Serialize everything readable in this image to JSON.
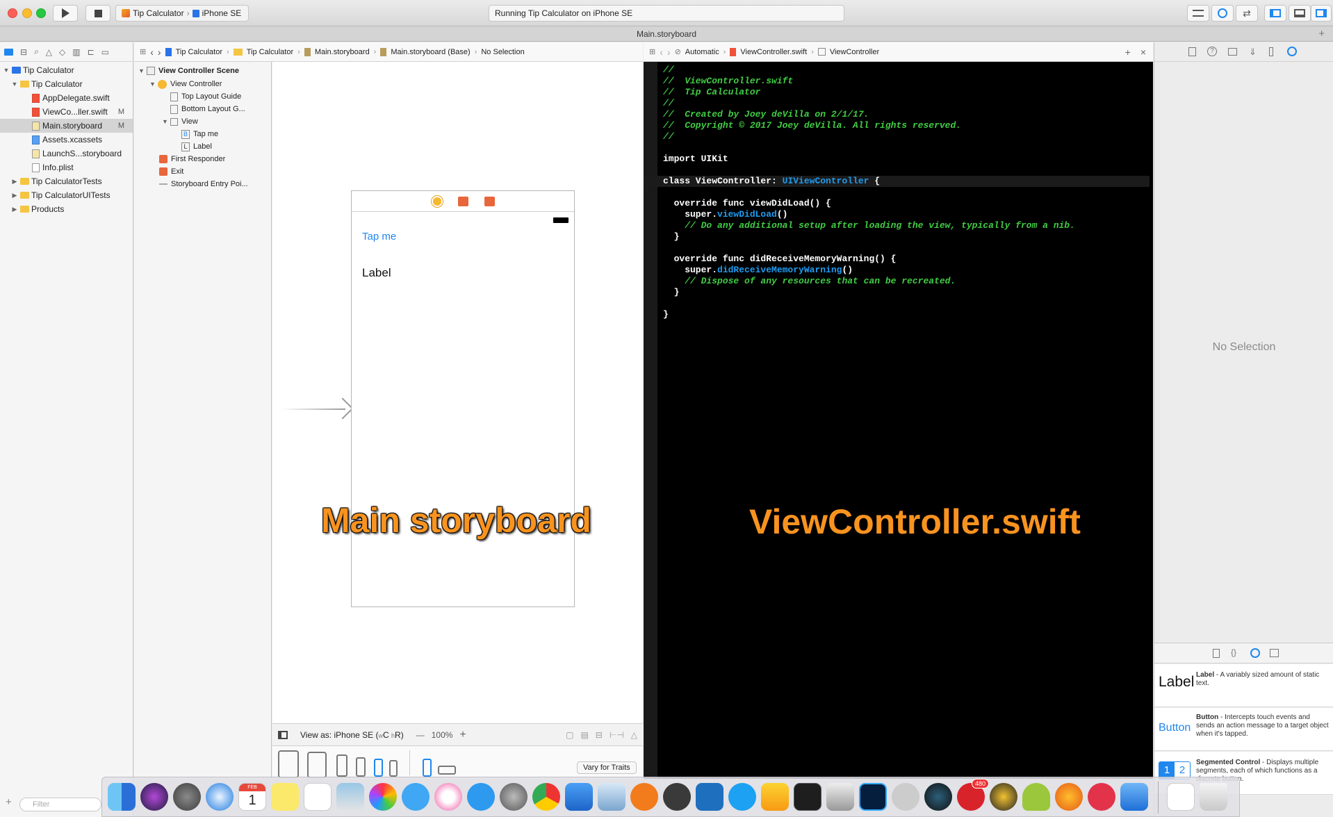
{
  "toolbar": {
    "scheme_project": "Tip Calculator",
    "scheme_device": "iPhone SE",
    "status": "Running Tip Calculator on iPhone SE"
  },
  "tab_title": "Main.storyboard",
  "navigator": {
    "items": [
      {
        "label": "Tip Calculator",
        "badge": ""
      },
      {
        "label": "Tip Calculator",
        "badge": ""
      },
      {
        "label": "AppDelegate.swift",
        "badge": ""
      },
      {
        "label": "ViewCo...ller.swift",
        "badge": "M"
      },
      {
        "label": "Main.storyboard",
        "badge": "M"
      },
      {
        "label": "Assets.xcassets",
        "badge": ""
      },
      {
        "label": "LaunchS...storyboard",
        "badge": ""
      },
      {
        "label": "Info.plist",
        "badge": ""
      },
      {
        "label": "Tip CalculatorTests",
        "badge": ""
      },
      {
        "label": "Tip CalculatorUITests",
        "badge": ""
      },
      {
        "label": "Products",
        "badge": ""
      }
    ],
    "filter_placeholder": "Filter"
  },
  "outline": {
    "scene": "View Controller Scene",
    "items": [
      "View Controller",
      "Top Layout Guide",
      "Bottom Layout G...",
      "View",
      "Tap me",
      "Label",
      "First Responder",
      "Exit",
      "Storyboard Entry Poi..."
    ],
    "item_icon_letters": [
      "B",
      "L"
    ]
  },
  "storyboard_jumpbar": [
    "Tip Calculator",
    "Tip Calculator",
    "Main.storyboard",
    "Main.storyboard (Base)",
    "No Selection"
  ],
  "code_jumpbar": [
    "Automatic",
    "ViewController.swift",
    "ViewController"
  ],
  "canvas": {
    "button_text": "Tap me",
    "label_text": "Label",
    "overlay_left": "Main storyboard",
    "view_as": "View as: iPhone SE (",
    "view_as_suffix": "C",
    "view_as_suffix2": "R)",
    "zoom": "100%",
    "vary_for_traits": "Vary for Traits"
  },
  "code": {
    "overlay_right": "ViewController.swift",
    "lines": [
      {
        "t": "//",
        "c": "cm"
      },
      {
        "t": "//  ViewController.swift",
        "c": "cm"
      },
      {
        "t": "//  Tip Calculator",
        "c": "cm"
      },
      {
        "t": "//",
        "c": "cm"
      },
      {
        "t": "//  Created by Joey deVilla on 2/1/17.",
        "c": "cm"
      },
      {
        "t": "//  Copyright © 2017 Joey deVilla. All rights reserved.",
        "c": "cm"
      },
      {
        "t": "//",
        "c": "cm"
      },
      {
        "t": "",
        "c": ""
      },
      {
        "t": "import UIKit",
        "c": "kw"
      },
      {
        "t": "",
        "c": ""
      },
      {
        "t": "class ViewController: ",
        "c": "kw",
        "type": "UIViewController",
        "tail": " {",
        "hl": true
      },
      {
        "t": "",
        "c": ""
      },
      {
        "t": "  override func viewDidLoad() {",
        "c": "kw"
      },
      {
        "t": "    super.",
        "c": "kw",
        "type": "viewDidLoad",
        "tail": "()"
      },
      {
        "t": "    // Do any additional setup after loading the view, typically from a nib.",
        "c": "cm"
      },
      {
        "t": "  }",
        "c": "kw"
      },
      {
        "t": "",
        "c": ""
      },
      {
        "t": "  override func didReceiveMemoryWarning() {",
        "c": "kw"
      },
      {
        "t": "    super.",
        "c": "kw",
        "type": "didReceiveMemoryWarning",
        "tail": "()"
      },
      {
        "t": "    // Dispose of any resources that can be recreated.",
        "c": "cm"
      },
      {
        "t": "  }",
        "c": "kw"
      },
      {
        "t": "",
        "c": ""
      },
      {
        "t": "}",
        "c": "kw"
      }
    ]
  },
  "inspector": {
    "empty_text": "No Selection",
    "library": [
      {
        "preview": "Label",
        "name": "Label",
        "desc": " - A variably sized amount of static text."
      },
      {
        "preview": "Button",
        "name": "Button",
        "desc": " - Intercepts touch events and sends an action message to a target object when it's tapped."
      },
      {
        "preview": "1 2",
        "name": "Segmented Control",
        "desc": " - Displays multiple segments, each of which functions as a discrete button."
      }
    ]
  },
  "dock": {
    "calendar_day": "1",
    "calendar_month": "FEB",
    "badge": "480"
  },
  "colors": {
    "accent": "#1f87ee",
    "overlay": "#f8931f",
    "comment": "#41cc45",
    "type": "#1f9cf0"
  }
}
